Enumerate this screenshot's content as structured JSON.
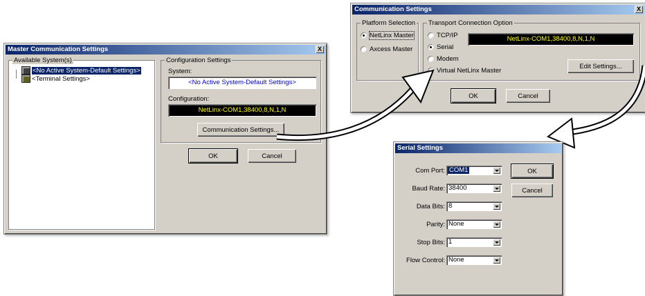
{
  "master": {
    "title": "Master Communication Settings",
    "close": "X",
    "available_label": "Available System(s)",
    "tree": [
      {
        "label": "<No Active System-Default Settings>"
      },
      {
        "label": "<Terminal Settings>"
      }
    ],
    "config_group": "Configuration Settings",
    "system_label": "System:",
    "system_value": "<No Active System-Default Settings>",
    "configuration_label": "Configuration:",
    "configuration_value": "NetLinx-COM1,38400,8,N,1,N",
    "comm_button": "Communication Settings...",
    "ok": "OK",
    "cancel": "Cancel"
  },
  "comm": {
    "title": "Communication Settings",
    "close": "X",
    "platform_group": "Platform Selection",
    "platform_options": [
      {
        "label": "NetLinx Master",
        "checked": true
      },
      {
        "label": "Axcess Master",
        "checked": false
      }
    ],
    "transport_group": "Transport Connection Option",
    "transport_options": [
      {
        "label": "TCP/IP",
        "checked": false
      },
      {
        "label": "Serial",
        "checked": true
      },
      {
        "label": "Modem",
        "checked": false
      },
      {
        "label": "Virtual NetLinx Master",
        "checked": false
      }
    ],
    "connection_value": "NetLinx-COM1,38400,8,N,1,N",
    "edit_button": "Edit Settings...",
    "ok": "OK",
    "cancel": "Cancel"
  },
  "serial": {
    "title": "Serial Settings",
    "fields": [
      {
        "label": "Com Port:",
        "value": "COM1"
      },
      {
        "label": "Baud Rate:",
        "value": "38400"
      },
      {
        "label": "Data Bits:",
        "value": "8"
      },
      {
        "label": "Parity:",
        "value": "None"
      },
      {
        "label": "Stop Bits:",
        "value": "1"
      },
      {
        "label": "Flow Control:",
        "value": "None"
      }
    ],
    "ok": "OK",
    "cancel": "Cancel"
  },
  "colors": {
    "title_gradient_start": "#0a246a",
    "title_gradient_end": "#a6caf0",
    "dialog_bg": "#d4d0c8",
    "config_display_bg": "#000000",
    "config_display_text": "#ffff00",
    "system_value_text": "#0000cc"
  },
  "icons": [
    "close-icon",
    "system-folder-icon",
    "terminal-icon",
    "dropdown-arrow-icon",
    "arrow-icon"
  ]
}
